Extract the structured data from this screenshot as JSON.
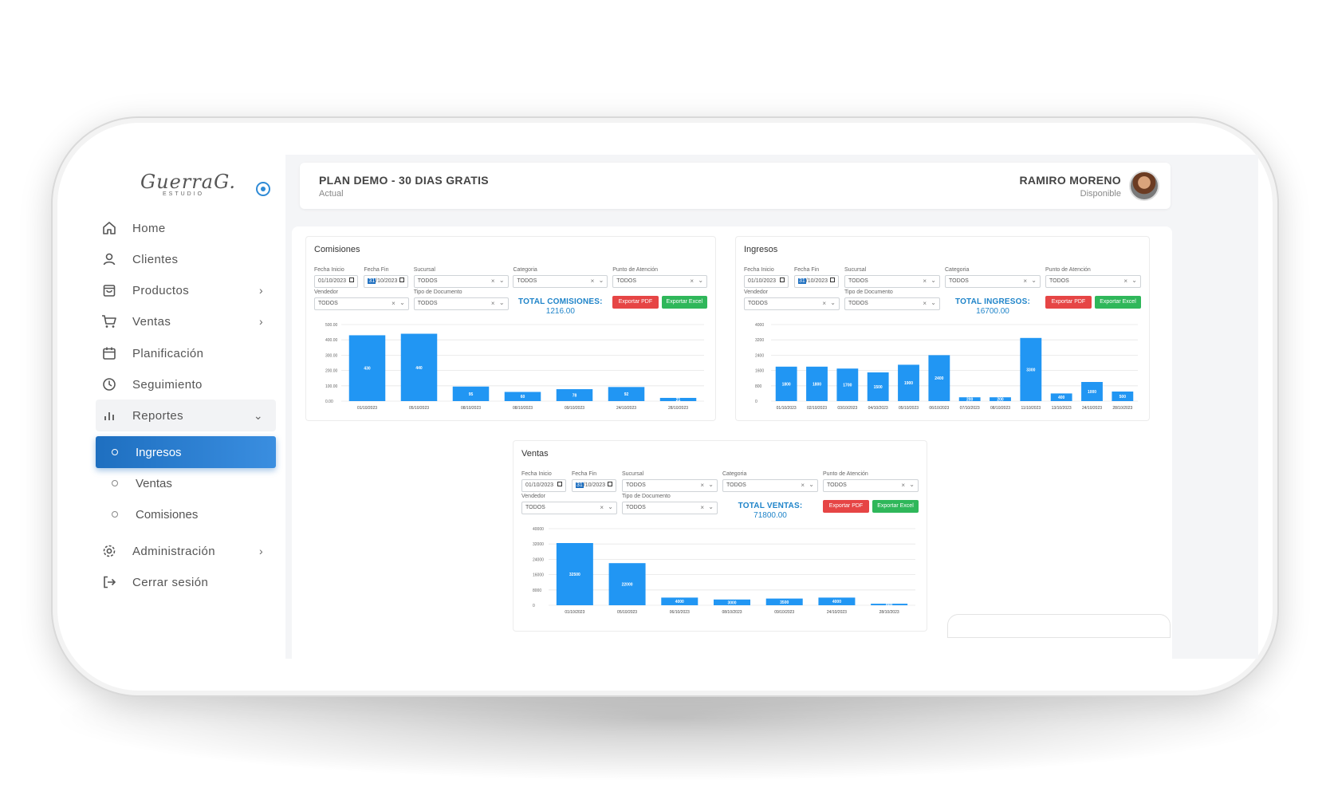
{
  "sidebar": {
    "logo_script": "GuerraG.",
    "logo_sub": "ESTUDIO",
    "items": [
      {
        "label": "Home",
        "icon": "home-icon"
      },
      {
        "label": "Clientes",
        "icon": "user-icon"
      },
      {
        "label": "Productos",
        "icon": "bag-icon",
        "chevron": "›"
      },
      {
        "label": "Ventas",
        "icon": "cart-icon",
        "chevron": "›"
      },
      {
        "label": "Planificación",
        "icon": "calendar-icon"
      },
      {
        "label": "Seguimiento",
        "icon": "clock-icon"
      },
      {
        "label": "Reportes",
        "icon": "bar-chart-icon",
        "chevron": "⌄"
      }
    ],
    "subitems": [
      {
        "label": "Ingresos",
        "active": true
      },
      {
        "label": "Ventas",
        "active": false
      },
      {
        "label": "Comisiones",
        "active": false
      }
    ],
    "bottom": [
      {
        "label": "Administración",
        "icon": "gear-icon",
        "chevron": "›"
      },
      {
        "label": "Cerrar sesión",
        "icon": "logout-icon"
      }
    ]
  },
  "header": {
    "plan_title": "PLAN DEMO - 30 DIAS GRATIS",
    "plan_sub": "Actual",
    "user_name": "RAMIRO MORENO",
    "user_status": "Disponible"
  },
  "filters_labels": {
    "fecha_inicio": "Fecha Inicio",
    "fecha_fin": "Fecha Fin",
    "sucursal": "Sucursal",
    "categoria": "Categoria",
    "punto": "Punto de Atención",
    "vendedor": "Vendedor",
    "tipo_doc": "Tipo de Documento",
    "todos": "TODOS",
    "date_start": "01/10/2023",
    "date_end_day": "31",
    "date_end_rest": "/10/2023",
    "btn_pdf": "Exportar PDF",
    "btn_xls": "Exportar Excel"
  },
  "cards": {
    "comisiones": {
      "title": "Comisiones",
      "total_label": "TOTAL COMISIONES:",
      "total_value": "1216.00"
    },
    "ingresos": {
      "title": "Ingresos",
      "total_label": "TOTAL INGRESOS:",
      "total_value": "16700.00"
    },
    "ventas": {
      "title": "Ventas",
      "total_label": "TOTAL VENTAS:",
      "total_value": "71800.00"
    }
  },
  "colors": {
    "accent": "#1e6fc0",
    "bar": "#2196f3",
    "total": "#1f84c9",
    "pdf": "#e64545",
    "excel": "#2fb75a"
  },
  "chart_data": [
    {
      "type": "bar",
      "title": "",
      "categories": [
        "01/10/2023",
        "05/10/2023",
        "08/10/2023",
        "08/10/2023",
        "09/10/2023",
        "24/10/2023",
        "28/10/2023"
      ],
      "values": [
        430,
        440,
        95,
        60,
        78,
        92,
        21
      ],
      "yticks": [
        "0.00",
        "100.00",
        "200.00",
        "300.00",
        "400.00",
        "500.00"
      ],
      "ylim": [
        0,
        500
      ],
      "grid": true
    },
    {
      "type": "bar",
      "title": "",
      "categories": [
        "01/10/2023",
        "02/10/2023",
        "03/10/2023",
        "04/10/2023",
        "05/10/2023",
        "06/10/2023",
        "07/10/2023",
        "08/10/2023",
        "11/10/2023",
        "13/10/2023",
        "24/10/2023",
        "28/10/2023"
      ],
      "values": [
        1800,
        1800,
        1700,
        1500,
        1900,
        2400,
        200,
        200,
        3300,
        400,
        1000,
        500
      ],
      "yticks": [
        "0",
        "800",
        "1600",
        "2400",
        "3200",
        "4000"
      ],
      "ylim": [
        0,
        4000
      ],
      "grid": true
    },
    {
      "type": "bar",
      "title": "",
      "categories": [
        "01/10/2023",
        "05/10/2023",
        "06/10/2023",
        "08/10/2023",
        "09/10/2023",
        "24/10/2023",
        "28/10/2023"
      ],
      "values": [
        32500,
        22000,
        4000,
        3000,
        3500,
        4000,
        800
      ],
      "yticks": [
        "0",
        "8000",
        "16000",
        "24000",
        "32000",
        "40000"
      ],
      "ylim": [
        0,
        40000
      ],
      "grid": true
    }
  ]
}
